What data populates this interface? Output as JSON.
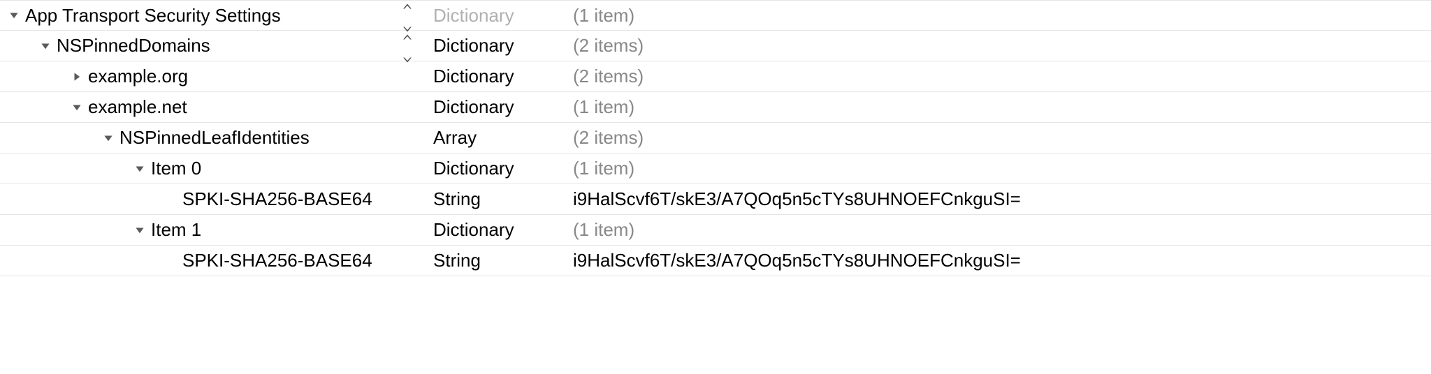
{
  "rows": [
    {
      "key": "App Transport Security Settings",
      "type": "Dictionary",
      "value": "(1 item)",
      "indent": 0,
      "disclosure": "down",
      "hasStepper": true,
      "typeDimmed": true,
      "valueDimmed": true
    },
    {
      "key": "NSPinnedDomains",
      "type": "Dictionary",
      "value": "(2 items)",
      "indent": 1,
      "disclosure": "down",
      "hasStepper": true,
      "typeDimmed": false,
      "valueDimmed": true
    },
    {
      "key": "example.org",
      "type": "Dictionary",
      "value": "(2 items)",
      "indent": 2,
      "disclosure": "right",
      "hasStepper": false,
      "typeDimmed": false,
      "valueDimmed": true
    },
    {
      "key": "example.net",
      "type": "Dictionary",
      "value": "(1 item)",
      "indent": 2,
      "disclosure": "down",
      "hasStepper": false,
      "typeDimmed": false,
      "valueDimmed": true
    },
    {
      "key": "NSPinnedLeafIdentities",
      "type": "Array",
      "value": "(2 items)",
      "indent": 3,
      "disclosure": "down",
      "hasStepper": false,
      "typeDimmed": false,
      "valueDimmed": true
    },
    {
      "key": "Item 0",
      "type": "Dictionary",
      "value": "(1 item)",
      "indent": 4,
      "disclosure": "down",
      "hasStepper": false,
      "typeDimmed": false,
      "valueDimmed": true
    },
    {
      "key": "SPKI-SHA256-BASE64",
      "type": "String",
      "value": "i9HalScvf6T/skE3/A7QOq5n5cTYs8UHNOEFCnkguSI=",
      "indent": 5,
      "disclosure": "none",
      "hasStepper": false,
      "typeDimmed": false,
      "valueDimmed": false
    },
    {
      "key": "Item 1",
      "type": "Dictionary",
      "value": "(1 item)",
      "indent": 4,
      "disclosure": "down",
      "hasStepper": false,
      "typeDimmed": false,
      "valueDimmed": true
    },
    {
      "key": "SPKI-SHA256-BASE64",
      "type": "String",
      "value": "i9HalScvf6T/skE3/A7QOq5n5cTYs8UHNOEFCnkguSI=",
      "indent": 5,
      "disclosure": "none",
      "hasStepper": false,
      "typeDimmed": false,
      "valueDimmed": false
    }
  ]
}
